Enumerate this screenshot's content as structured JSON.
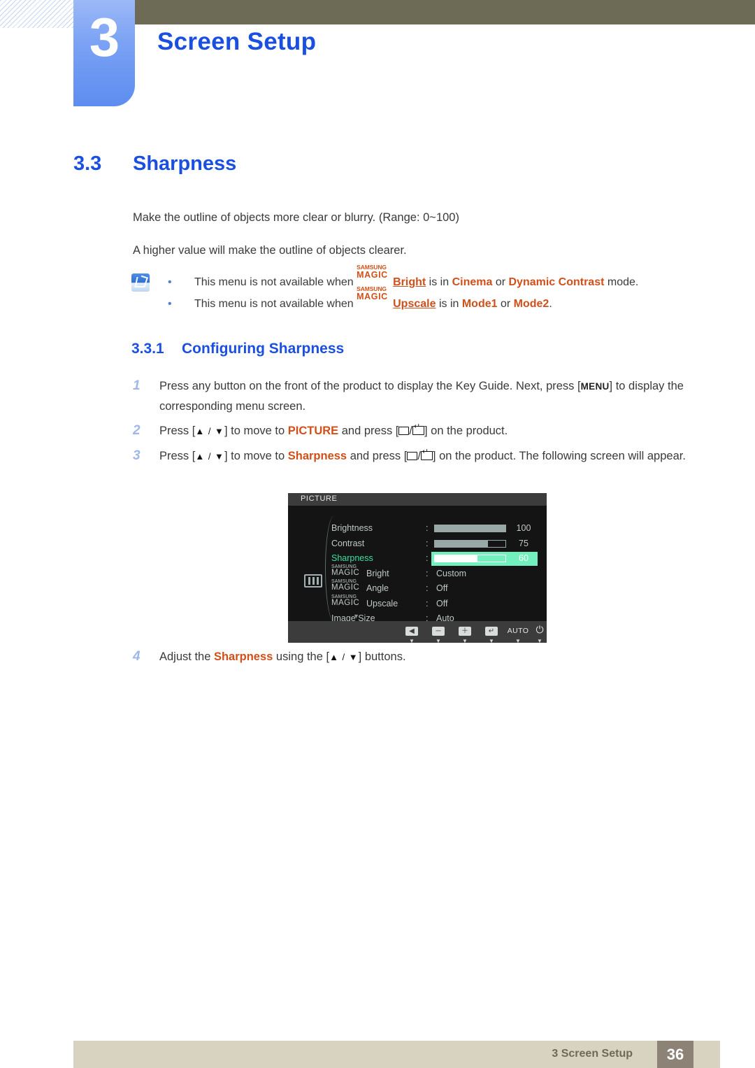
{
  "header": {
    "chapter_number": "3",
    "chapter_title": "Screen Setup"
  },
  "section": {
    "number": "3.3",
    "title": "Sharpness"
  },
  "paragraphs": {
    "p1": "Make the outline of objects more clear or blurry. (Range: 0~100)",
    "p2": "A higher value will make the outline of objects clearer."
  },
  "note": {
    "icon": "note-pencil-icon",
    "items": [
      {
        "bullet": "•",
        "prefix": "This menu is not available when ",
        "magic_top": "SAMSUNG",
        "magic_bottom": "MAGIC",
        "feature": "Bright",
        "mid": " is in ",
        "value1": "Cinema",
        "conj": " or ",
        "value2": "Dynamic Contrast",
        "suffix": " mode."
      },
      {
        "bullet": "•",
        "prefix": "This menu is not available when ",
        "magic_top": "SAMSUNG",
        "magic_bottom": "MAGIC",
        "feature": "Upscale",
        "mid": " is in ",
        "value1": "Mode1",
        "conj": " or ",
        "value2": "Mode2",
        "suffix": "."
      }
    ]
  },
  "subsection": {
    "number": "3.3.1",
    "title": "Configuring Sharpness"
  },
  "steps": [
    {
      "number": "1",
      "t1": "Press any button on the front of the product to display the Key Guide. Next, press [",
      "key": "MENU",
      "t2": "] to display the corresponding menu screen."
    },
    {
      "number": "2",
      "t1": "Press [",
      "arrows": "▲ / ▼",
      "t2": "] to move to ",
      "target": "PICTURE",
      "t3": " and press [",
      "t4": "] on the product."
    },
    {
      "number": "3",
      "t1": "Press [",
      "arrows": "▲ / ▼",
      "t2": "] to move to ",
      "target": "Sharpness",
      "t3": " and press [",
      "t4": "] on the product. The following screen will appear."
    },
    {
      "number": "4",
      "t1": "Adjust the ",
      "target": "Sharpness",
      "t2": " using the [",
      "arrows": "▲ / ▼",
      "t3": "] buttons."
    }
  ],
  "osd": {
    "title": "PICTURE",
    "category_icon": "picture-bars-icon",
    "scroll_down_icon": "▼",
    "rows": [
      {
        "label": "Brightness",
        "colon": ":",
        "type": "bar",
        "fill_percent": 100,
        "number": "100"
      },
      {
        "label": "Contrast",
        "colon": ":",
        "type": "bar",
        "fill_percent": 75,
        "number": "75"
      },
      {
        "label": "Sharpness",
        "colon": ":",
        "type": "bar",
        "fill_percent": 60,
        "number": "60",
        "selected": true
      },
      {
        "magic_top": "SAMSUNG",
        "magic_bottom": "MAGIC",
        "label": "Bright",
        "colon": ":",
        "type": "value",
        "value": "Custom"
      },
      {
        "magic_top": "SAMSUNG",
        "magic_bottom": "MAGIC",
        "label": "Angle",
        "colon": ":",
        "type": "value",
        "value": "Off"
      },
      {
        "magic_top": "SAMSUNG",
        "magic_bottom": "MAGIC",
        "label": "Upscale",
        "colon": ":",
        "type": "value",
        "value": "Off"
      },
      {
        "label": "Image Size",
        "colon": ":",
        "type": "value",
        "value": "Auto"
      }
    ],
    "toolbar": [
      {
        "name": "back-button",
        "glyph": "◀",
        "kind": "icon",
        "tick": "▼"
      },
      {
        "name": "minus-button",
        "glyph": "─",
        "kind": "icon",
        "tick": "▼"
      },
      {
        "name": "plus-button",
        "glyph": "＋",
        "kind": "icon",
        "tick": "▼"
      },
      {
        "name": "enter-button",
        "glyph": "↵",
        "kind": "icon",
        "tick": "▼"
      },
      {
        "name": "auto-button",
        "glyph": "AUTO",
        "kind": "text",
        "tick": "▼"
      },
      {
        "name": "power-button",
        "glyph": "⏻",
        "kind": "power",
        "tick": "▼"
      }
    ],
    "colors": {
      "background": "#141414",
      "titlebar": "#3c3c3c",
      "text": "#bfc9c7",
      "highlight": "#72f0bd",
      "selected_label": "#39e0a0"
    }
  },
  "footer": {
    "label": "3 Screen Setup",
    "page": "36"
  },
  "theme": {
    "heading_blue": "#1a4fe0",
    "accent_orange": "#d1501a",
    "olive": "#6d6a55",
    "footer_tan": "#d8d3c0",
    "page_box": "#8c8275"
  }
}
